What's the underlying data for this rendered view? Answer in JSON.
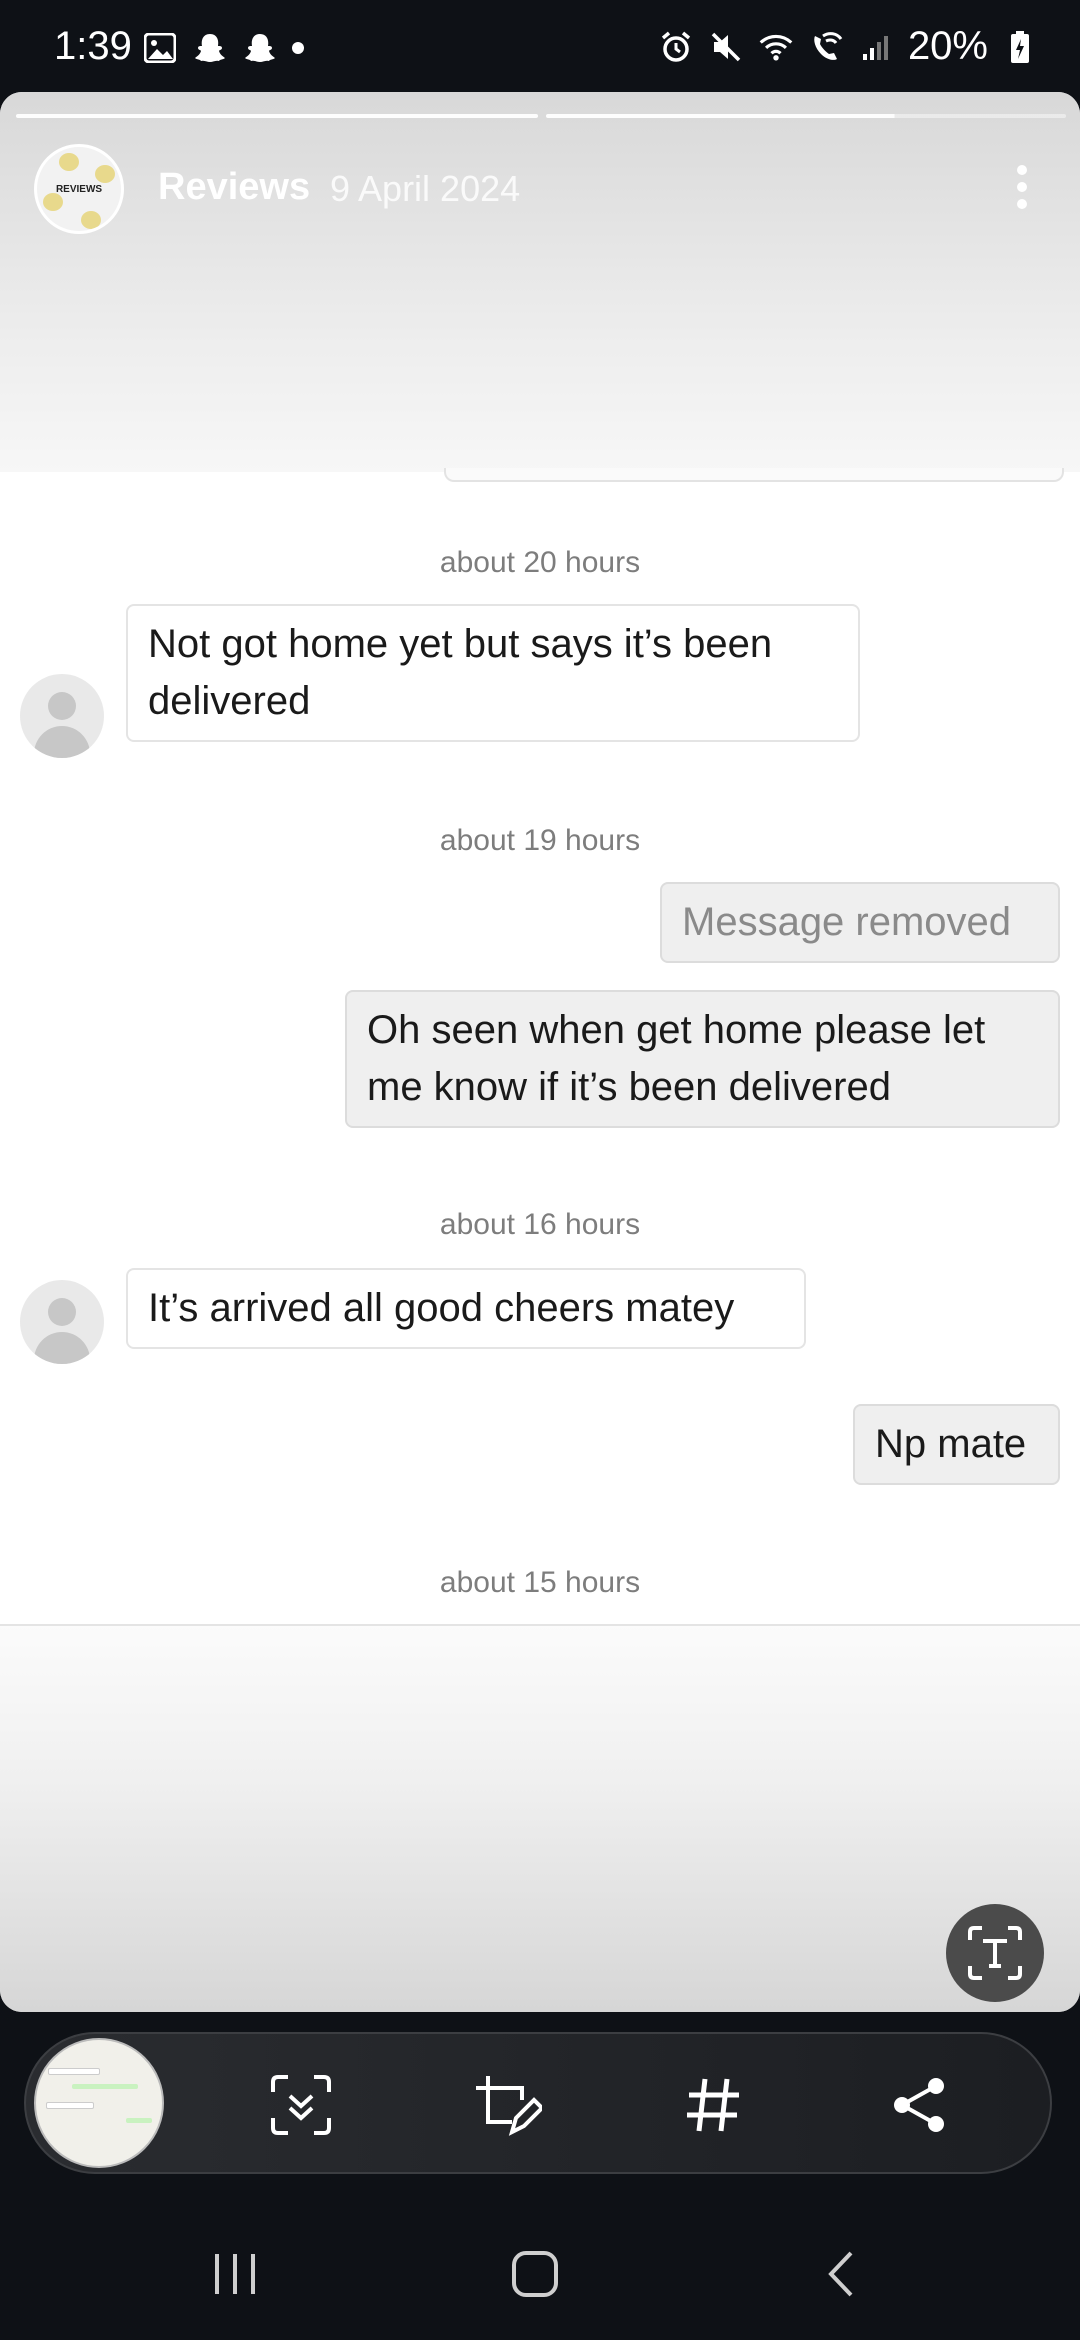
{
  "status_bar": {
    "time": "1:39",
    "battery": "20%",
    "left_icons": [
      "gallery-icon",
      "snapchat-icon",
      "snapchat-icon",
      "dot"
    ],
    "right_icons": [
      "alarm-icon",
      "mute-icon",
      "wifi-icon",
      "wifi-call-icon",
      "signal-icon",
      "battery-charging-icon"
    ]
  },
  "story": {
    "account_name": "Reviews",
    "date": "9 April 2024",
    "avatar_text": "REVIEWS",
    "progress_segments": 2
  },
  "chat": {
    "messages": [
      {
        "type": "timestamp",
        "text": "about 20 hours"
      },
      {
        "type": "incoming",
        "text": "Not got home yet but says it’s been delivered"
      },
      {
        "type": "timestamp",
        "text": "about 19 hours"
      },
      {
        "type": "outgoing",
        "text": "Message removed",
        "removed": true
      },
      {
        "type": "outgoing",
        "text": "Oh seen when get home please let me know if it’s been delivered"
      },
      {
        "type": "timestamp",
        "text": "about 16 hours"
      },
      {
        "type": "incoming",
        "text": "It’s arrived all good cheers matey"
      },
      {
        "type": "outgoing",
        "text": "Np mate"
      },
      {
        "type": "timestamp",
        "text": "about 15 hours"
      }
    ]
  },
  "toolbar": {
    "items": [
      "screenshot-thumbnail",
      "scroll-capture-icon",
      "crop-edit-icon",
      "hashtag-icon",
      "share-icon"
    ]
  },
  "nav_bar": {
    "items": [
      "recents-icon",
      "home-icon",
      "back-icon"
    ]
  },
  "colors": {
    "background": "#0e1116",
    "card": "#ffffff",
    "timestamp": "#7d7d7d",
    "text": "#1a1a1a"
  }
}
